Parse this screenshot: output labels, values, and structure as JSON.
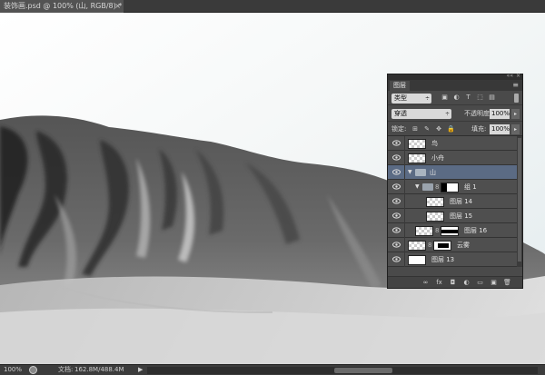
{
  "document": {
    "tab_title": "装饰画.psd @ 100% (山, RGB/8) *",
    "close_symbol": "×"
  },
  "status": {
    "zoom": "100%",
    "doc_label": "文档:",
    "doc_size": "162.8M/488.4M",
    "arrow": "▶"
  },
  "layers_panel": {
    "tab_label": "图层",
    "collapse_symbol": "««",
    "close_symbol": "×",
    "menu_symbol": "≡",
    "filter": {
      "kind_label": "类型",
      "arrow": "÷",
      "icons": [
        "image-filter-icon",
        "adjustment-filter-icon",
        "type-filter-icon",
        "shape-filter-icon",
        "smart-object-filter-icon"
      ]
    },
    "blend": {
      "mode": "穿透",
      "arrow": "÷",
      "opacity_label": "不透明度:",
      "opacity_value": "100%",
      "dropdown_arrow": "▸"
    },
    "lock": {
      "label": "锁定:",
      "fill_label": "填充:",
      "fill_value": "100%",
      "dropdown_arrow": "▸",
      "icons": [
        "lock-transparent-icon",
        "lock-pixels-icon",
        "lock-position-icon",
        "lock-all-icon"
      ]
    },
    "layers": [
      {
        "name": "鸟",
        "type": "layer",
        "indent": 0,
        "selected": false
      },
      {
        "name": "小舟",
        "type": "layer",
        "indent": 0,
        "selected": false
      },
      {
        "name": "山",
        "type": "group",
        "indent": 0,
        "selected": true,
        "expanded": true
      },
      {
        "name": "组 1",
        "type": "group",
        "indent": 1,
        "selected": false,
        "expanded": true,
        "has_mask": true
      },
      {
        "name": "图层 14",
        "type": "layer",
        "indent": 2,
        "selected": false
      },
      {
        "name": "图层 15",
        "type": "layer",
        "indent": 2,
        "selected": false
      },
      {
        "name": "图层 16",
        "type": "layer",
        "indent": 1,
        "selected": false,
        "has_mask": true
      },
      {
        "name": "云雾",
        "type": "layer",
        "indent": 0,
        "selected": false,
        "has_mask": true
      },
      {
        "name": "图层 13",
        "type": "layer",
        "indent": 0,
        "selected": false,
        "white_thumb": true
      }
    ],
    "footer_icons": [
      "link-layers-icon",
      "fx-icon",
      "add-mask-icon",
      "adjustment-layer-icon",
      "new-group-icon",
      "new-layer-icon",
      "trash-icon"
    ],
    "footer_glyphs": [
      "∞",
      "fx",
      "◘",
      "◐",
      "▭",
      "▣",
      "🗑"
    ]
  },
  "colors": {
    "panel_bg": "#4a4a4a",
    "selected_layer": "#5b6b84",
    "sky": "#eef3f5",
    "mountain_dark": "#3e3e3e"
  }
}
